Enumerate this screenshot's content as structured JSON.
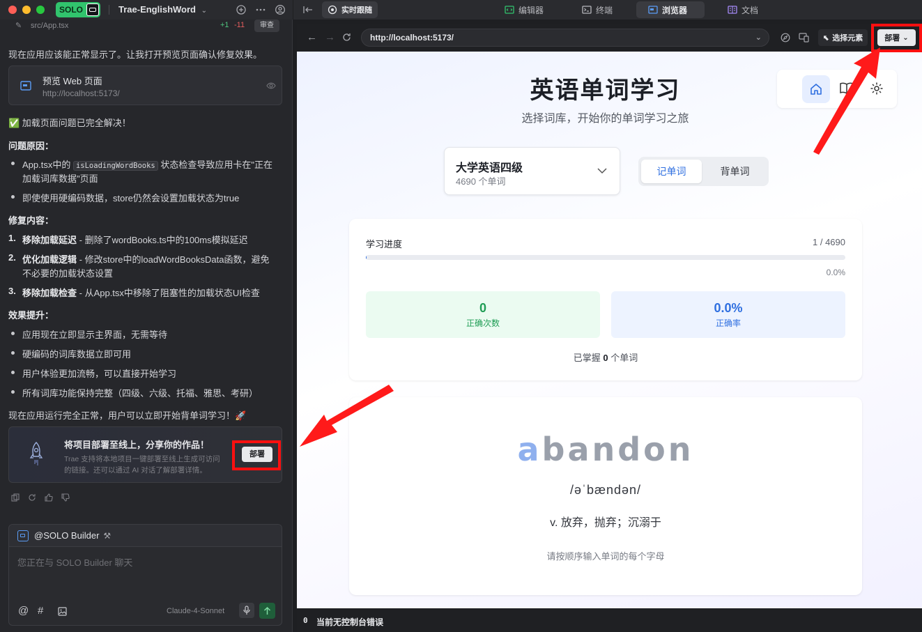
{
  "titlebar": {
    "app_badge": "SOLO",
    "project": "Trae-EnglishWord"
  },
  "chat": {
    "file": {
      "name": "src/App.tsx",
      "added": "+1",
      "removed": "-11",
      "review": "审查"
    },
    "intro": "现在应用应该能正常显示了。让我打开预览页面确认修复效果。",
    "preview_card": {
      "title": "预览 Web 页面",
      "url": "http://localhost:5173/"
    },
    "solved": "✅ 加载页面问题已完全解决！",
    "cause_heading": "问题原因：",
    "cause_items": [
      {
        "pre": "App.tsx中的 ",
        "code": "isLoadingWordBooks",
        "post": " 状态检查导致应用卡在\"正在",
        "line2": "加载词库数据\"页面"
      },
      {
        "text": "即使使用硬编码数据，store仍然会设置加载状态为true"
      }
    ],
    "fix_heading": "修复内容：",
    "fix_items": [
      {
        "num": "1.",
        "title": "移除加载延迟",
        "desc": " - 删除了wordBooks.ts中的100ms模拟延迟"
      },
      {
        "num": "2.",
        "title": "优化加载逻辑",
        "desc": " - 修改store中的loadWordBooksData函数，避免",
        "line2": "不必要的加载状态设置"
      },
      {
        "num": "3.",
        "title": "移除加载检查",
        "desc": " - 从App.tsx中移除了阻塞性的加载状态UI检查"
      }
    ],
    "effect_heading": "效果提升：",
    "effect_items": [
      "应用现在立即显示主界面，无需等待",
      "硬编码的词库数据立即可用",
      "用户体验更加流畅，可以直接开始学习",
      "所有词库功能保持完整（四级、六级、托福、雅思、考研）"
    ],
    "closing": "现在应用运行完全正常，用户可以立即开始背单词学习！🚀",
    "deploy_card": {
      "title": "将项目部署至线上，分享你的作品！",
      "desc1": "Trae 支持将本地项目一键部署至线上生成可访问",
      "desc2": "的链接。还可以通过 AI 对话了解部署详情。",
      "button": "部署"
    }
  },
  "input": {
    "agent": "@SOLO Builder",
    "placeholder": "您正在与 SOLO Builder 聊天",
    "model": "Claude-4-Sonnet"
  },
  "topbar": {
    "follow": "实时跟随",
    "tabs": [
      "编辑器",
      "终端",
      "浏览器",
      "文档"
    ],
    "active_tab": "浏览器"
  },
  "browser": {
    "url": "http://localhost:5173/",
    "select_element": "选择元素",
    "deploy": "部署"
  },
  "app": {
    "title": "英语单词学习",
    "subtitle": "选择词库，开始你的单词学习之旅",
    "wordbook": {
      "name": "大学英语四级",
      "count": "4690 个单词"
    },
    "modes": [
      "记单词",
      "背单词"
    ],
    "progress": {
      "label": "学习进度",
      "count": "1 / 4690",
      "percent": "0.0%",
      "fraction": 0.0002
    },
    "stats": [
      {
        "value": "0",
        "label": "正确次数"
      },
      {
        "value": "0.0%",
        "label": "正确率"
      }
    ],
    "mastered": {
      "pre": "已掌握 ",
      "num": "0",
      "post": " 个单词"
    },
    "word": {
      "typed": "a",
      "rest": "bandon",
      "phonetic": "/əˈbændən/",
      "meaning": "v. 放弃，抛弃；沉溺于",
      "hint": "请按顺序输入单词的每个字母"
    }
  },
  "status": {
    "count": "0",
    "text": "当前无控制台错误"
  },
  "colors": {
    "accent_green": "#31c46d",
    "annotation_red": "#ff1010",
    "app_blue": "#2f6fe0"
  }
}
